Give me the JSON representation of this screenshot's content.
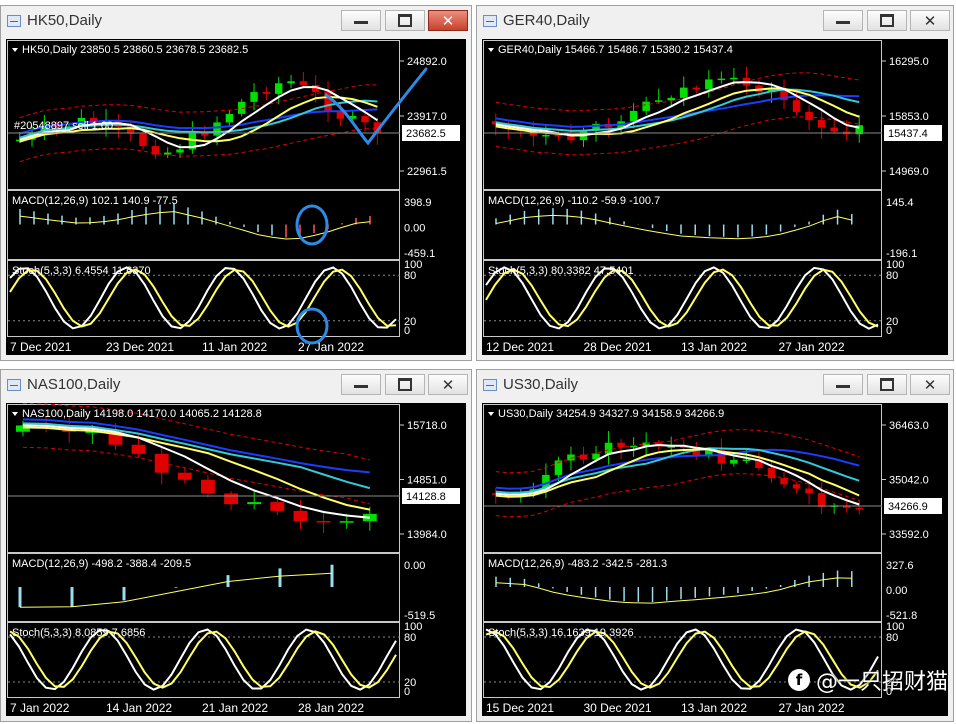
{
  "colors": {
    "bg": "#000000",
    "grid": "#3a3a3a",
    "up": "#00e000",
    "down": "#e00000",
    "white": "#ffffff",
    "yellow": "#ffff66",
    "blue": "#1c3cff",
    "cyan": "#33c9d9",
    "macd": "#99ddee",
    "macdRed": "#ff5555",
    "annot": "#2e8be5"
  },
  "watermark": {
    "logo": "f",
    "text": "@一只招财猫"
  },
  "charts": [
    {
      "key": "hk50",
      "title": "HK50,Daily",
      "active": true,
      "header": "HK50,Daily  23850.5 23860.5 23678.5 23682.5",
      "order_label": "#20548897 sell 1.00",
      "price_ticks": [
        "24892.0",
        "23917.0",
        "22961.5"
      ],
      "price_current": "23682.5",
      "macd_label": "MACD(12,26,9) 102.1 140.9 -77.5",
      "macd_ticks": [
        "398.9",
        "0.00",
        "-459.1"
      ],
      "stoch_label": "Stoch(5,3,3) 6.4554 11.6370",
      "stoch_ticks": [
        "100",
        "80",
        "20",
        "0"
      ],
      "dates": [
        "7 Dec 2021",
        "23 Dec 2021",
        "11 Jan 2022",
        "27 Jan 2022"
      ]
    },
    {
      "key": "ger40",
      "title": "GER40,Daily",
      "active": false,
      "header": "GER40,Daily  15466.7 15486.7 15380.2 15437.4",
      "order_label": "",
      "price_ticks": [
        "16295.0",
        "15853.0",
        "14969.0"
      ],
      "price_current": "15437.4",
      "macd_label": "MACD(12,26,9) -110.2 -59.9 -100.7",
      "macd_ticks": [
        "145.4",
        "-196.1"
      ],
      "stoch_label": "Stoch(5,3,3) 80.3382 47.5401",
      "stoch_ticks": [
        "100",
        "80",
        "20",
        "0"
      ],
      "dates": [
        "12 Dec 2021",
        "28 Dec 2021",
        "13 Jan 2022",
        "27 Jan 2022"
      ]
    },
    {
      "key": "nas100",
      "title": "NAS100,Daily",
      "active": false,
      "header": "NAS100,Daily  14198.0 14170.0 14065.2 14128.8",
      "order_label": "",
      "price_ticks": [
        "15718.0",
        "14851.0",
        "13984.0"
      ],
      "price_current": "14128.8",
      "macd_label": "MACD(12,26,9) -498.2 -388.4 -209.5",
      "macd_ticks": [
        "0.00",
        "-519.5"
      ],
      "stoch_label": "Stoch(5,3,3) 8.0859 7.6856",
      "stoch_ticks": [
        "100",
        "80",
        "20",
        "0"
      ],
      "dates": [
        "7 Jan 2022",
        "14 Jan 2022",
        "21 Jan 2022",
        "28 Jan 2022"
      ]
    },
    {
      "key": "us30",
      "title": "US30,Daily",
      "active": false,
      "header": "US30,Daily  34254.9 34327.9 34158.9 34266.9",
      "order_label": "",
      "price_ticks": [
        "36463.0",
        "35042.0",
        "33592.0"
      ],
      "price_current": "34266.9",
      "macd_label": "MACD(12,26,9) -483.2 -342.5 -281.3",
      "macd_ticks": [
        "327.6",
        "0.00",
        "-521.8"
      ],
      "stoch_label": "Stoch(5,3,3) 16.1639 19.3926",
      "stoch_ticks": [
        "100",
        "80",
        "20",
        "0"
      ],
      "dates": [
        "15 Dec 2021",
        "30 Dec 2021",
        "13 Jan 2022",
        "27 Jan 2022"
      ]
    }
  ]
}
